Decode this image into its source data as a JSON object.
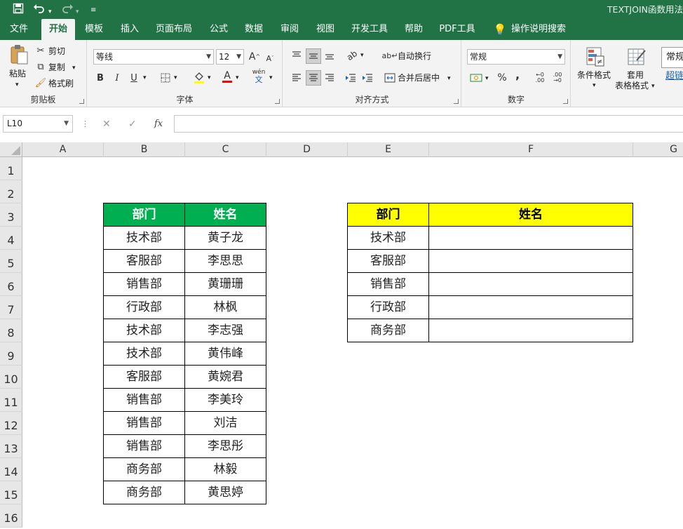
{
  "title_bar": {
    "doc_title": "TEXTJOIN函数用法",
    "quick_access": [
      "save-icon",
      "undo-icon",
      "redo-icon",
      "customize-icon"
    ]
  },
  "tabs": [
    {
      "label": "文件",
      "active": false
    },
    {
      "label": "开始",
      "active": true
    },
    {
      "label": "模板",
      "active": false
    },
    {
      "label": "插入",
      "active": false
    },
    {
      "label": "页面布局",
      "active": false
    },
    {
      "label": "公式",
      "active": false
    },
    {
      "label": "数据",
      "active": false
    },
    {
      "label": "审阅",
      "active": false
    },
    {
      "label": "视图",
      "active": false
    },
    {
      "label": "开发工具",
      "active": false
    },
    {
      "label": "帮助",
      "active": false
    },
    {
      "label": "PDF工具",
      "active": false
    }
  ],
  "tell_me": "操作说明搜索",
  "ribbon": {
    "clipboard": {
      "label": "剪贴板",
      "paste": "粘贴",
      "cut": "剪切",
      "copy": "复制",
      "format_painter": "格式刷"
    },
    "font": {
      "label": "字体",
      "name": "等线",
      "size": "12",
      "bold": "B",
      "italic": "I",
      "underline": "U",
      "grow": "A",
      "shrink": "A",
      "font_color": "A",
      "phonetic": "wén"
    },
    "alignment": {
      "label": "对齐方式",
      "wrap": "自动换行",
      "merge": "合并后居中"
    },
    "number": {
      "label": "数字",
      "format": "常规",
      "percent": "%",
      "comma": ","
    },
    "styles": {
      "conditional": "条件格式",
      "table": "套用",
      "table2": "表格格式",
      "cell_style": "常规",
      "hyperlink": "超链"
    }
  },
  "formula_bar": {
    "name_box": "L10",
    "cancel": "✕",
    "enter": "✓",
    "fx": "fx",
    "value": ""
  },
  "columns": [
    "A",
    "B",
    "C",
    "D",
    "E",
    "F",
    "G"
  ],
  "rows": [
    "1",
    "2",
    "3",
    "4",
    "5",
    "6",
    "7",
    "8",
    "9",
    "10",
    "11",
    "12",
    "13",
    "14",
    "15",
    "16"
  ],
  "colors": {
    "brand": "#217346",
    "header_green": "#00b050",
    "header_yellow": "#ffff00"
  },
  "table_left": {
    "headers": [
      "部门",
      "姓名"
    ],
    "rows": [
      [
        "技术部",
        "黄子龙"
      ],
      [
        "客服部",
        "李思思"
      ],
      [
        "销售部",
        "黄珊珊"
      ],
      [
        "行政部",
        "林枫"
      ],
      [
        "技术部",
        "李志强"
      ],
      [
        "技术部",
        "黄伟峰"
      ],
      [
        "客服部",
        "黄婉君"
      ],
      [
        "销售部",
        "李美玲"
      ],
      [
        "销售部",
        "刘洁"
      ],
      [
        "销售部",
        "李思彤"
      ],
      [
        "商务部",
        "林毅"
      ],
      [
        "商务部",
        "黄思婷"
      ]
    ]
  },
  "table_right": {
    "headers": [
      "部门",
      "姓名"
    ],
    "rows": [
      [
        "技术部",
        ""
      ],
      [
        "客服部",
        ""
      ],
      [
        "销售部",
        ""
      ],
      [
        "行政部",
        ""
      ],
      [
        "商务部",
        ""
      ]
    ]
  }
}
